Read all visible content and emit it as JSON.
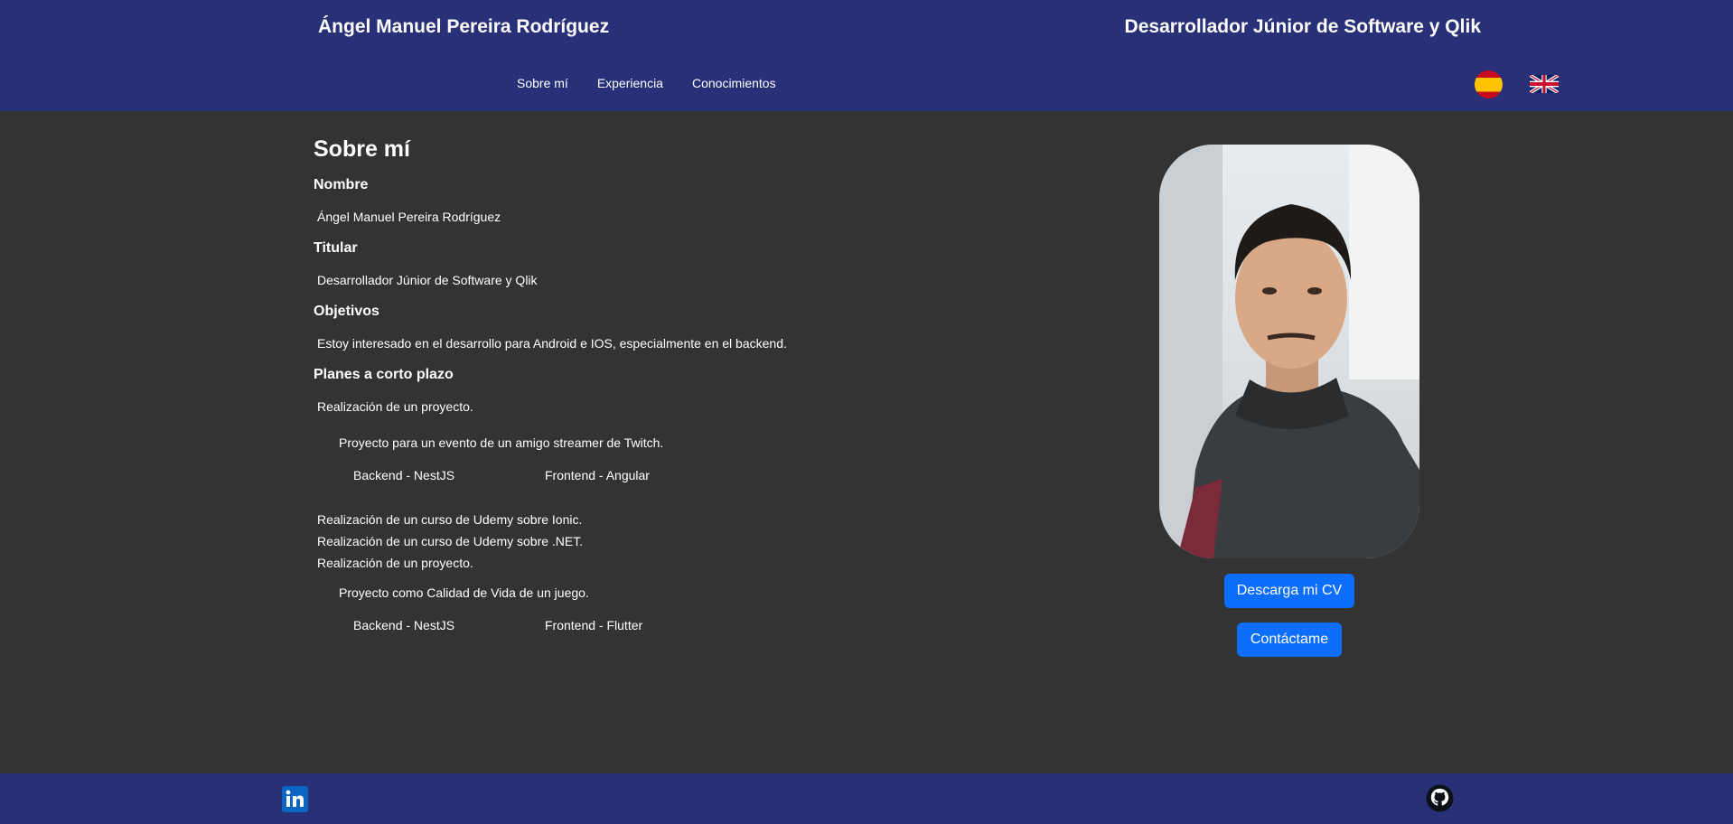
{
  "header": {
    "name": "Ángel Manuel Pereira Rodríguez",
    "role": "Desarrollador Júnior de Software y Qlik"
  },
  "nav": {
    "items": [
      {
        "label": "Sobre mí"
      },
      {
        "label": "Experiencia"
      },
      {
        "label": "Conocimientos"
      }
    ]
  },
  "languages": [
    "es-flag-icon",
    "uk-flag-icon"
  ],
  "about": {
    "title": "Sobre mí",
    "name_label": "Nombre",
    "name_value": "Ángel Manuel Pereira Rodríguez",
    "titular_label": "Titular",
    "titular_value": "Desarrollador Júnior de Software y Qlik",
    "objetivos_label": "Objetivos",
    "objetivos_value": "Estoy interesado en el desarrollo para Android e IOS, especialmente en el backend.",
    "planes_label": "Planes a corto plazo",
    "plan1": {
      "title": "Realización de un proyecto.",
      "description": "Proyecto para un evento de un amigo streamer de Twitch.",
      "backend": "Backend - NestJS",
      "frontend": "Frontend - Angular"
    },
    "course1": "Realización de un curso de Udemy sobre Ionic.",
    "course2": "Realización de un curso de Udemy sobre .NET.",
    "plan2": {
      "title": "Realización de un proyecto.",
      "description": "Proyecto como Calidad de Vida de un juego.",
      "backend": "Backend - NestJS",
      "frontend": "Frontend - Flutter"
    }
  },
  "buttons": {
    "cv": "Descarga mi CV",
    "contact": "Contáctame"
  },
  "footer": {
    "icons": [
      "linkedin-icon",
      "github-icon"
    ]
  },
  "colors": {
    "header_bg": "#283178",
    "page_bg": "#333333",
    "button_bg": "#0d6efd"
  }
}
